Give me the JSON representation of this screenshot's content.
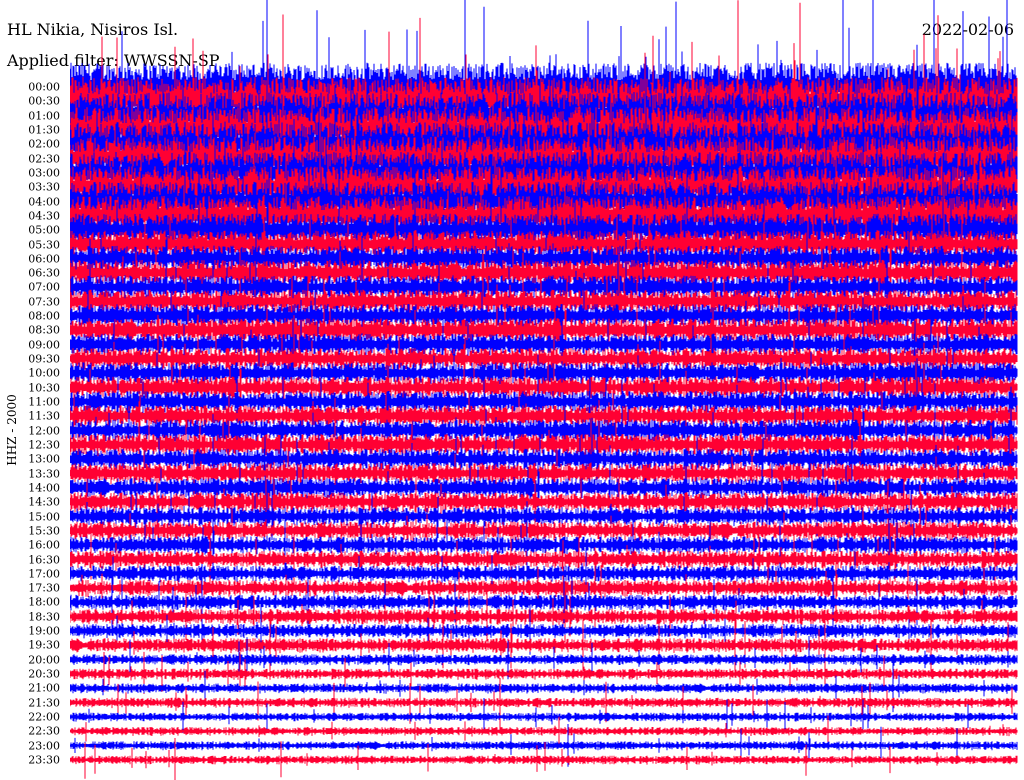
{
  "header": {
    "station": "HL Nikia, Nisiros Isl.",
    "filter": "Applied filter: WWSSN-SP",
    "date": "2022-02-06"
  },
  "channel_label": "HHZ - 2000",
  "colors": {
    "trace_a": "#0000ff",
    "trace_b": "#ff0033",
    "background": "#ffffff"
  },
  "chart_data": {
    "type": "helicorder",
    "row_labels": [
      "00:00",
      "00:30",
      "01:00",
      "01:30",
      "02:00",
      "02:30",
      "03:00",
      "03:30",
      "04:00",
      "04:30",
      "05:00",
      "05:30",
      "06:00",
      "06:30",
      "07:00",
      "07:30",
      "08:00",
      "08:30",
      "09:00",
      "09:30",
      "10:00",
      "10:30",
      "11:00",
      "11:30",
      "12:00",
      "12:30",
      "13:00",
      "13:30",
      "14:00",
      "14:30",
      "15:00",
      "15:30",
      "16:00",
      "16:30",
      "17:00",
      "17:30",
      "18:00",
      "18:30",
      "19:00",
      "19:30",
      "20:00",
      "20:30",
      "21:00",
      "21:30",
      "22:00",
      "22:30",
      "23:00",
      "23:30"
    ],
    "trace_colors": [
      "#0000ff",
      "#ff0033"
    ],
    "noise_level": [
      2.2,
      2.2,
      2.1,
      2.1,
      2.0,
      2.0,
      1.9,
      1.9,
      1.8,
      1.8,
      1.5,
      1.3,
      1.2,
      1.2,
      1.1,
      1.1,
      1.1,
      1.1,
      1.0,
      1.0,
      1.0,
      1.0,
      1.0,
      1.0,
      1.0,
      1.0,
      0.95,
      0.95,
      0.9,
      0.9,
      0.85,
      0.85,
      0.8,
      0.8,
      0.75,
      0.75,
      0.7,
      0.7,
      0.65,
      0.65,
      0.5,
      0.5,
      0.45,
      0.45,
      0.4,
      0.4,
      0.4,
      0.4
    ]
  }
}
